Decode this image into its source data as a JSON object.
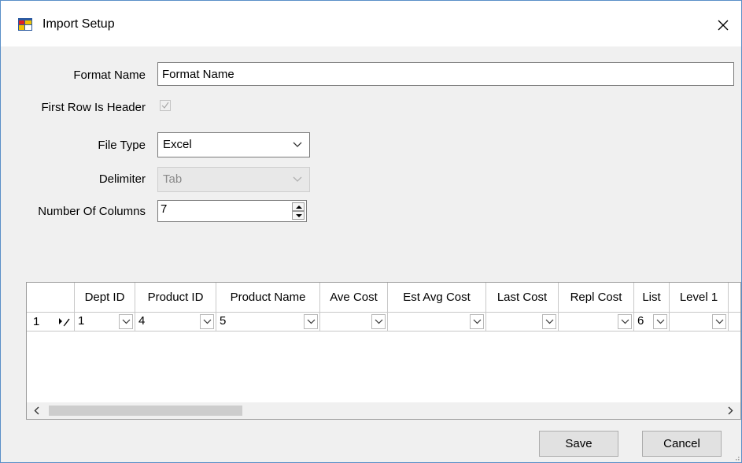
{
  "window": {
    "title": "Import Setup",
    "close_symbol": "✕",
    "icon": "import-setup-app-icon"
  },
  "form": {
    "format_name_label": "Format Name",
    "format_name_value": "Format Name",
    "first_row_header_label": "First Row Is Header",
    "first_row_header_checked": true,
    "file_type_label": "File Type",
    "file_type_value": "Excel",
    "delimiter_label": "Delimiter",
    "delimiter_value": "Tab",
    "num_columns_label": "Number Of Columns",
    "num_columns_value": "7"
  },
  "grid": {
    "columns": [
      "Dept ID",
      "Product ID",
      "Product Name",
      "Ave Cost",
      "Est Avg Cost",
      "Last Cost",
      "Repl Cost",
      "List",
      "Level 1"
    ],
    "row": {
      "row_number": "1",
      "cells": [
        "1",
        "4",
        "5",
        "",
        "",
        "",
        "",
        "6",
        ""
      ]
    },
    "scroll_left": "<",
    "scroll_right": ">"
  },
  "buttons": {
    "save": "Save",
    "cancel": "Cancel"
  },
  "colors": {
    "window_border": "#5a8fc8",
    "background": "#f0f0f0",
    "button_face": "#e1e1e1"
  }
}
